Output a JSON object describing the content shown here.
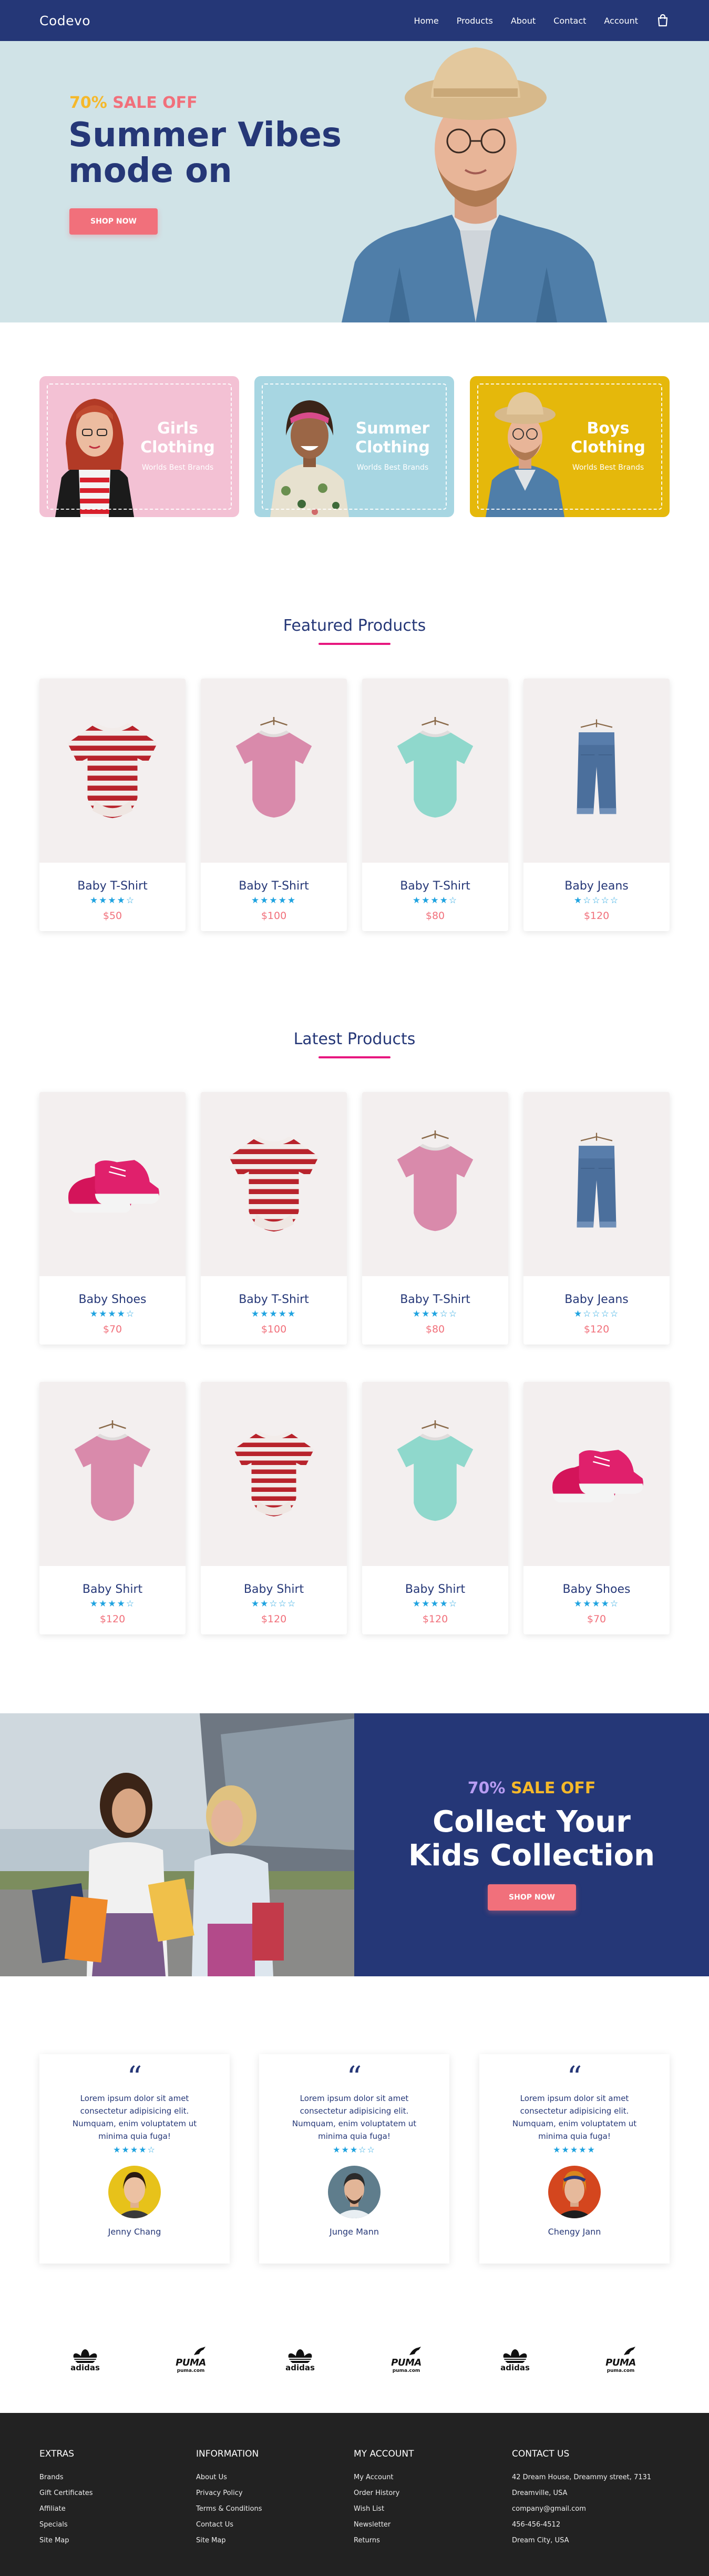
{
  "nav": {
    "logo": "Codevo",
    "links": [
      "Home",
      "Products",
      "About",
      "Contact",
      "Account"
    ]
  },
  "hero": {
    "sale_pct": "70%",
    "sale_rest": " SALE OFF",
    "title_line1": "Summer Vibes",
    "title_line2": "mode on",
    "button": "SHOP NOW"
  },
  "categories": [
    {
      "title_line1": "Girls",
      "title_line2": "Clothing",
      "subtitle": "Worlds Best Brands",
      "color": "#f3c1d4"
    },
    {
      "title_line1": "Summer",
      "title_line2": "Clothing",
      "subtitle": "Worlds Best Brands",
      "color": "#a7d6e2"
    },
    {
      "title_line1": "Boys",
      "title_line2": "Clothing",
      "subtitle": "Worlds Best Brands",
      "color": "#e5b80b"
    }
  ],
  "featured": {
    "title": "Featured Products",
    "products": [
      {
        "name": "Baby T-Shirt",
        "stars": "★★★★☆",
        "price": "$50"
      },
      {
        "name": "Baby T-Shirt",
        "stars": "★★★★★",
        "price": "$100"
      },
      {
        "name": "Baby T-Shirt",
        "stars": "★★★★☆",
        "price": "$80"
      },
      {
        "name": "Baby Jeans",
        "stars": "★☆☆☆☆",
        "price": "$120"
      }
    ]
  },
  "latest": {
    "title": "Latest Products",
    "products": [
      {
        "name": "Baby Shoes",
        "stars": "★★★★☆",
        "price": "$70"
      },
      {
        "name": "Baby T-Shirt",
        "stars": "★★★★★",
        "price": "$100"
      },
      {
        "name": "Baby T-Shirt",
        "stars": "★★★☆☆",
        "price": "$80"
      },
      {
        "name": "Baby Jeans",
        "stars": "★☆☆☆☆",
        "price": "$120"
      },
      {
        "name": "Baby Shirt",
        "stars": "★★★★☆",
        "price": "$120"
      },
      {
        "name": "Baby Shirt",
        "stars": "★★☆☆☆",
        "price": "$120"
      },
      {
        "name": "Baby Shirt",
        "stars": "★★★★☆",
        "price": "$120"
      },
      {
        "name": "Baby Shoes",
        "stars": "★★★★☆",
        "price": "$70"
      }
    ]
  },
  "promo": {
    "sale_pct": "70%",
    "sale_rest": " SALE OFF",
    "title_line1": "Collect Your",
    "title_line2": "Kids Collection",
    "button": "SHOP NOW"
  },
  "testimonials": [
    {
      "quote": "“",
      "text": "Lorem ipsum dolor sit amet consectetur adipisicing elit. Numquam, enim voluptatem ut minima quia fuga!",
      "stars": "★★★★☆",
      "name": "Jenny Chang"
    },
    {
      "quote": "“",
      "text": "Lorem ipsum dolor sit amet consectetur adipisicing elit. Numquam, enim voluptatem ut minima quia fuga!",
      "stars": "★★★☆☆",
      "name": "Junge Mann"
    },
    {
      "quote": "“",
      "text": "Lorem ipsum dolor sit amet consectetur adipisicing elit. Numquam, enim voluptatem ut minima quia fuga!",
      "stars": "★★★★★",
      "name": "Chengy Jann"
    }
  ],
  "brands": [
    {
      "type": "adidas",
      "text": "adidas"
    },
    {
      "type": "puma",
      "text": "PUMA",
      "sub": "puma.com"
    },
    {
      "type": "adidas",
      "text": "adidas"
    },
    {
      "type": "puma",
      "text": "PUMA",
      "sub": "puma.com"
    },
    {
      "type": "adidas",
      "text": "adidas"
    },
    {
      "type": "puma",
      "text": "PUMA",
      "sub": "puma.com"
    }
  ],
  "footer": {
    "extras": {
      "heading": "EXTRAS",
      "items": [
        "Brands",
        "Gift Certificates",
        "Affiliate",
        "Specials",
        "Site Map"
      ]
    },
    "information": {
      "heading": "INFORMATION",
      "items": [
        "About Us",
        "Privacy Policy",
        "Terms & Conditions",
        "Contact Us",
        "Site Map"
      ]
    },
    "account": {
      "heading": "MY ACCOUNT",
      "items": [
        "My Account",
        "Order History",
        "Wish List",
        "Newsletter",
        "Returns"
      ]
    },
    "contact": {
      "heading": "CONTACT US",
      "items": [
        "42 Dream House, Dreammy street, 7131",
        "Dreamville, USA",
        "company@gmail.com",
        "456-456-4512",
        "Dream City, USA"
      ]
    }
  },
  "colors": {
    "navy": "#253777",
    "accent": "#f1707b",
    "yellow": "#f5b82a",
    "star": "#1fa3e0",
    "underline": "#e7177f",
    "footer": "#222222"
  }
}
